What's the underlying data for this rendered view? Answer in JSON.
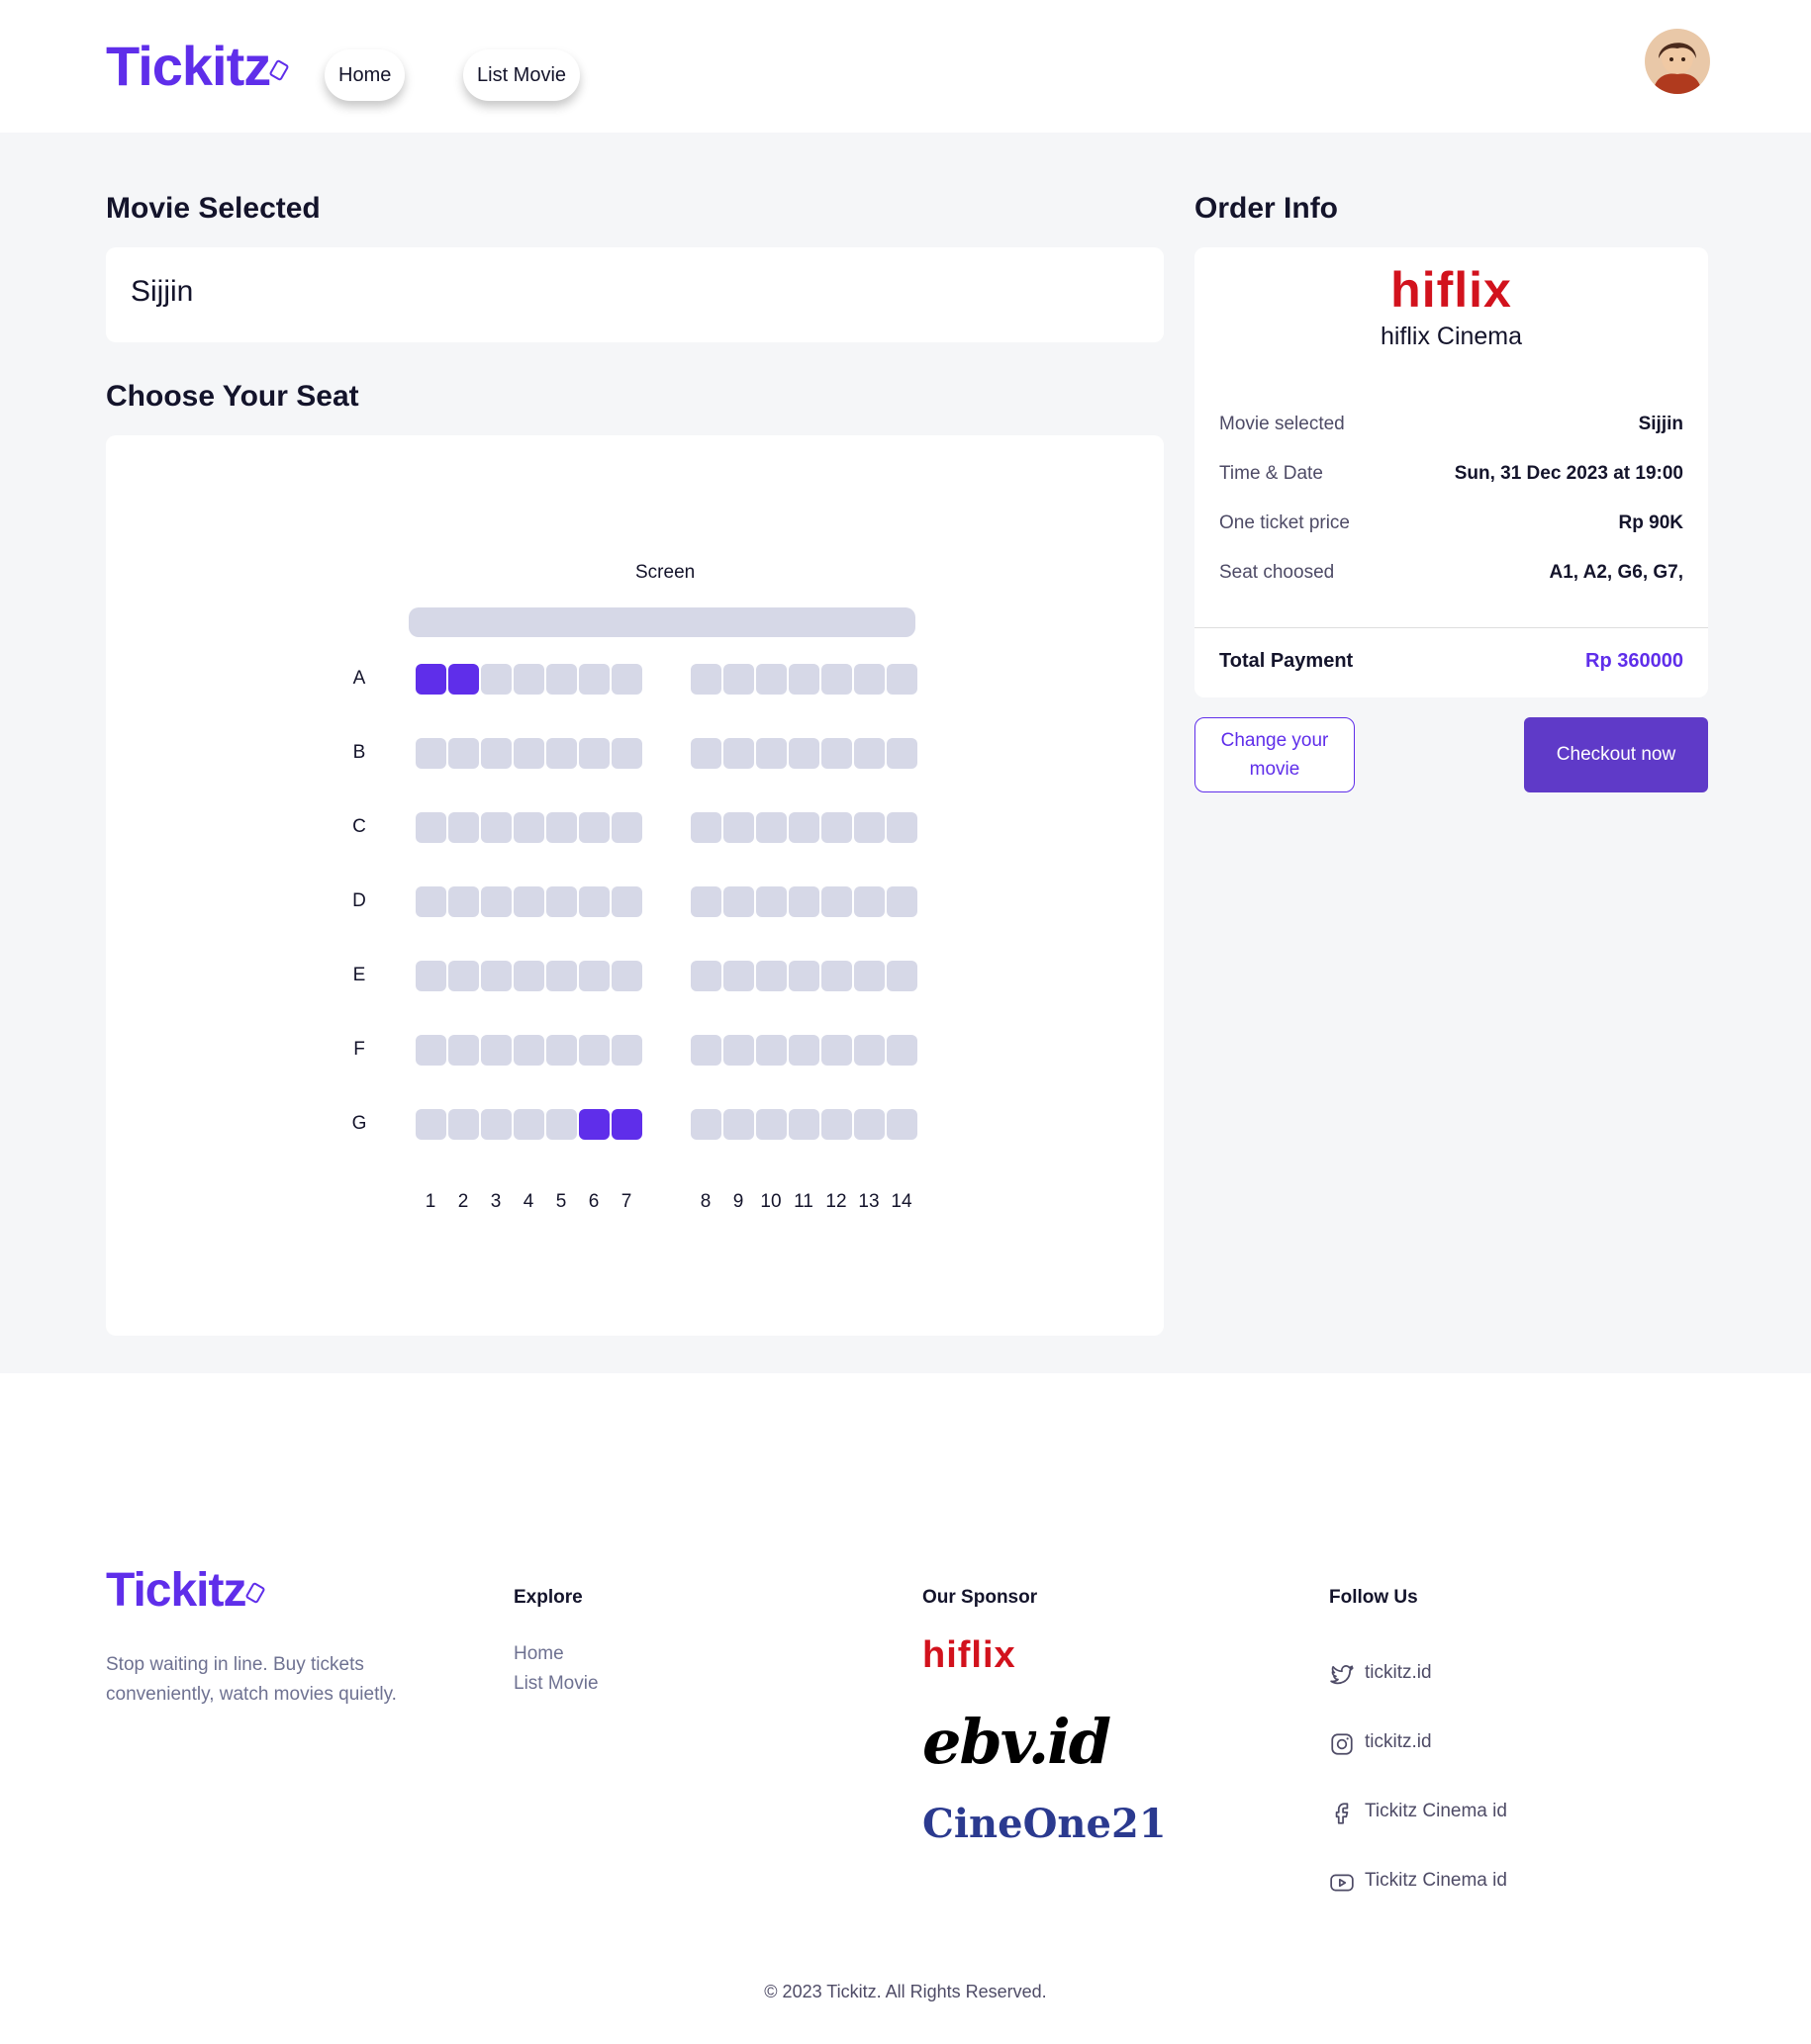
{
  "brand": {
    "name": "Tickitz",
    "accent": "#5f2eea"
  },
  "nav": {
    "home": "Home",
    "list_movie": "List Movie"
  },
  "movie_section": {
    "title": "Movie Selected",
    "movie_name": "Sijjin"
  },
  "seat_section": {
    "title": "Choose Your Seat",
    "screen_label": "Screen",
    "rows": [
      "A",
      "B",
      "C",
      "D",
      "E",
      "F",
      "G"
    ],
    "columns": [
      "1",
      "2",
      "3",
      "4",
      "5",
      "6",
      "7",
      "8",
      "9",
      "10",
      "11",
      "12",
      "13",
      "14"
    ],
    "selected_seats": [
      "A1",
      "A2",
      "G6",
      "G7"
    ],
    "seat_color": "#d6d8e7",
    "selected_color": "#5f2eea"
  },
  "order": {
    "title": "Order Info",
    "cinema_logo": "hiflix",
    "cinema_name": "hiflix Cinema",
    "rows": [
      {
        "label": "Movie selected",
        "value": "Sijjin"
      },
      {
        "label": "Time & Date",
        "value": "Sun, 31 Dec 2023 at 19:00"
      },
      {
        "label": "One ticket price",
        "value": "Rp 90K"
      },
      {
        "label": "Seat choosed",
        "value": "A1, A2, G6, G7,"
      }
    ],
    "total_label": "Total Payment",
    "total_value": "Rp 360000",
    "change_button": "Change your movie",
    "checkout_button": "Checkout now"
  },
  "footer": {
    "tagline": "Stop waiting in line. Buy tickets conveniently, watch movies quietly.",
    "explore_title": "Explore",
    "explore_links": [
      "Home",
      "List Movie"
    ],
    "sponsor_title": "Our Sponsor",
    "sponsors": [
      "hiflix",
      "ebv.id",
      "CineOne21"
    ],
    "follow_title": "Follow Us",
    "follow": [
      {
        "icon": "twitter-icon",
        "label": "tickitz.id"
      },
      {
        "icon": "instagram-icon",
        "label": "tickitz.id"
      },
      {
        "icon": "facebook-icon",
        "label": "Tickitz Cinema id"
      },
      {
        "icon": "youtube-icon",
        "label": "Tickitz Cinema id"
      }
    ],
    "copyright": "© 2023 Tickitz. All Rights Reserved."
  }
}
